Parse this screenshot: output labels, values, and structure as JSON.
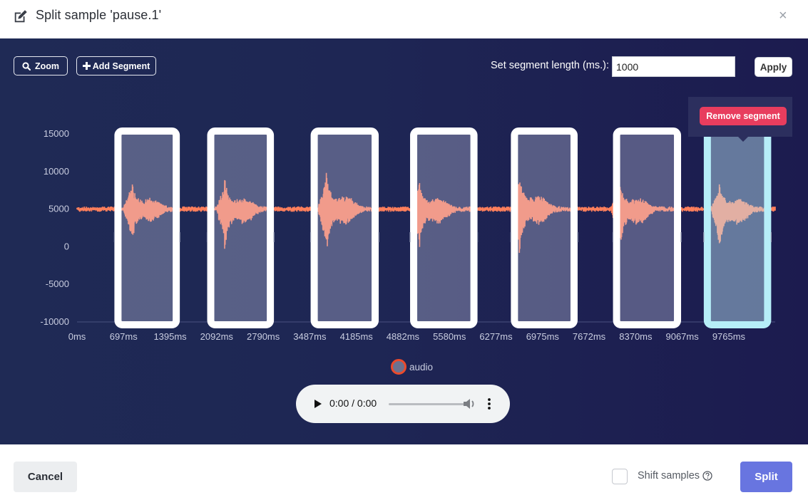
{
  "dialog": {
    "title": "Split sample 'pause.1'",
    "close_glyph": "×",
    "edit_icon": "edit-icon"
  },
  "toolbar": {
    "zoom_label": "Zoom",
    "zoom_icon": "search-icon",
    "add_segment_label": "Add Segment",
    "add_segment_icon": "plus-icon",
    "segment_length_label": "Set segment length (ms.):",
    "segment_length_value": "1000",
    "apply_label": "Apply"
  },
  "popover": {
    "remove_segment_label": "Remove segment"
  },
  "colors": {
    "waveform": "#ff7f5c",
    "segment_fill": "#f2f2ff",
    "segment_border": "#ffffff",
    "selected_segment_border": "#b6eef8",
    "background_left": "#1f2a55",
    "background_right": "#1c1b4f",
    "remove_button": "#e83d5e",
    "split_button": "#6875e0"
  },
  "chart_data": {
    "type": "line",
    "y_ticks": [
      "15000",
      "10000",
      "5000",
      "0",
      "-5000",
      "-10000"
    ],
    "x_ticks": [
      "0ms",
      "697ms",
      "1395ms",
      "2092ms",
      "2790ms",
      "3487ms",
      "4185ms",
      "4882ms",
      "5580ms",
      "6277ms",
      "6975ms",
      "7672ms",
      "8370ms",
      "9067ms",
      "9765ms"
    ],
    "ylim": [
      -10000,
      15000
    ],
    "xlim_ms": [
      0,
      10460
    ],
    "baseline": 5000,
    "grid": false,
    "series": [
      {
        "name": "audio",
        "bursts": [
          {
            "start_ms": 697,
            "peak_ms": 815,
            "max": 9000,
            "min": -100
          },
          {
            "start_ms": 2092,
            "peak_ms": 2210,
            "max": 9200,
            "min": -1000
          },
          {
            "start_ms": 3650,
            "peak_ms": 3730,
            "max": 10200,
            "min": -1300
          },
          {
            "start_ms": 5000,
            "peak_ms": 5120,
            "max": 9300,
            "min": -900
          },
          {
            "start_ms": 6500,
            "peak_ms": 6620,
            "max": 10500,
            "min": -1300
          },
          {
            "start_ms": 8000,
            "peak_ms": 8120,
            "max": 9100,
            "min": -1300
          },
          {
            "start_ms": 9500,
            "peak_ms": 9620,
            "max": 8700,
            "min": -1300
          }
        ]
      }
    ],
    "segments_ms": [
      [
        560,
        1540
      ],
      [
        1950,
        2950
      ],
      [
        3500,
        4520
      ],
      [
        4990,
        6000
      ],
      [
        6500,
        7500
      ],
      [
        8030,
        9050
      ],
      [
        9390,
        10400
      ]
    ],
    "selected_segment_index": 6
  },
  "legend": {
    "label": "audio"
  },
  "audio_player": {
    "time": "0:00 / 0:00",
    "progress": 0
  },
  "footer": {
    "cancel_label": "Cancel",
    "shift_samples_label": "Shift samples",
    "shift_samples_checked": false,
    "split_label": "Split"
  }
}
